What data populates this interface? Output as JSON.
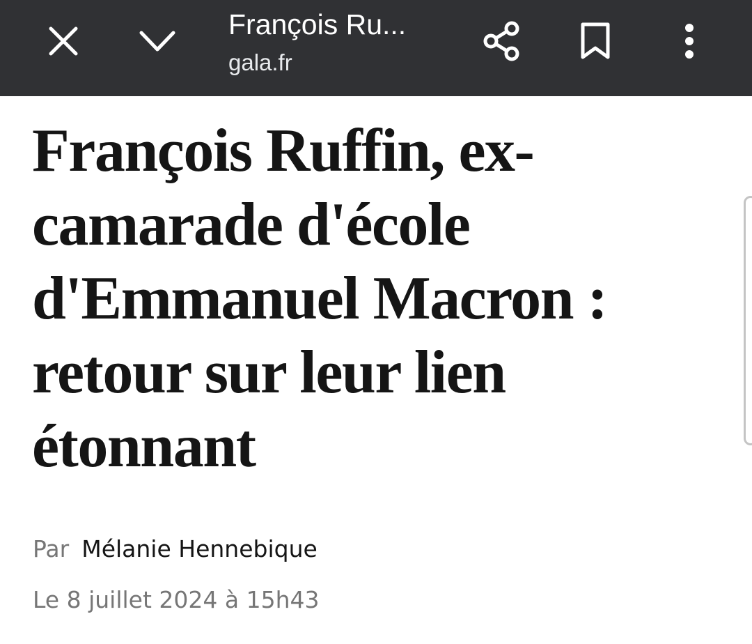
{
  "toolbar": {
    "title": "François Ru...",
    "domain": "gala.fr",
    "close_icon": "close-icon",
    "minimize_icon": "chevron-down-icon",
    "share_icon": "share-icon",
    "bookmark_icon": "bookmark-icon",
    "menu_icon": "more-vert-icon",
    "background_color": "#303134",
    "icon_color": "#ffffff"
  },
  "article": {
    "headline": "François Ruffin, ex-camarade d'école d'Emmanuel Macron : retour sur leur lien étonnant",
    "byline_prefix": "Par",
    "author": "Mélanie Hennebique",
    "date": "Le 8 juillet 2024 à 15h43",
    "text_color": "#151515",
    "meta_color": "#767676"
  }
}
